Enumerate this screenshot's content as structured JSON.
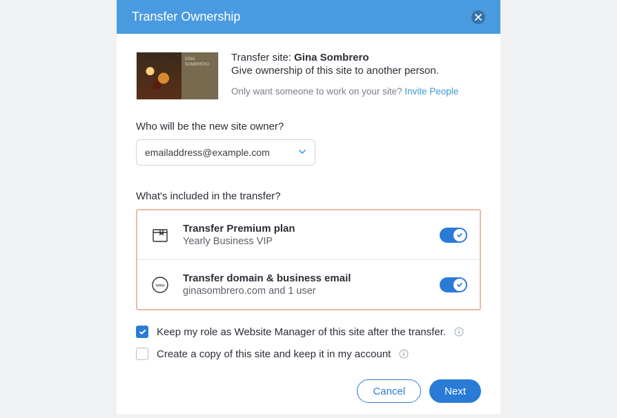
{
  "modal": {
    "title": "Transfer Ownership"
  },
  "site": {
    "transfer_prefix": "Transfer site: ",
    "name": "Gina Sombrero",
    "thumb_label": "GINA SOMBRERO",
    "description": "Give ownership of this site to another person.",
    "hint_prefix": "Only want someone to work on your site? ",
    "hint_link": "Invite People"
  },
  "owner_field": {
    "label": "Who will be the new site owner?",
    "value": "emailaddress@example.com"
  },
  "included": {
    "label": "What's included in the transfer?",
    "items": [
      {
        "title": "Transfer Premium plan",
        "subtitle": "Yearly Business VIP",
        "on": true
      },
      {
        "title": "Transfer domain & business email",
        "subtitle": "ginasombrero.com and 1 user",
        "on": true
      }
    ]
  },
  "options": {
    "keep_role": "Keep my role as Website Manager of this site after the transfer.",
    "create_copy": "Create a copy of this site and keep it in my account"
  },
  "footer": {
    "cancel": "Cancel",
    "next": "Next"
  }
}
